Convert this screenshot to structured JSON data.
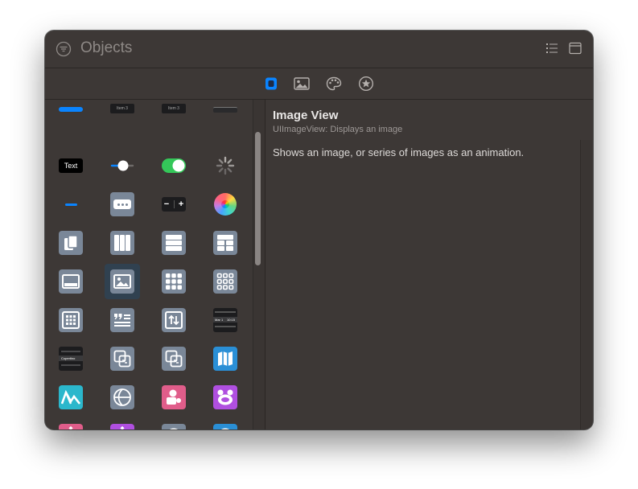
{
  "window": {
    "title": "Objects"
  },
  "tabs": [
    {
      "name": "objects",
      "icon": "objects-icon",
      "active": true
    },
    {
      "name": "media",
      "icon": "image-icon",
      "active": false
    },
    {
      "name": "colors",
      "icon": "palette-icon",
      "active": false
    },
    {
      "name": "snippets",
      "icon": "star-icon",
      "active": false
    }
  ],
  "library": {
    "row0": {
      "item_label_1": "Item 3",
      "item_label_2": "Item 3"
    },
    "row1": {
      "label_text": "Text"
    },
    "row2": {
      "stepper_minus": "−",
      "stepper_plus": "+"
    },
    "row6": {
      "picker_lines": [
        "Cupertino"
      ],
      "date_picker_lines": [
        "Mar 1",
        "10:15"
      ]
    }
  },
  "detail": {
    "title": "Image View",
    "subtitle": "UIImageView: Displays an image",
    "description": "Shows an image, or series of images as an animation."
  },
  "colors": {
    "accent": "#0a84ff",
    "switch_on": "#34c759",
    "tile": "#7a8798",
    "background": "#3d3836"
  }
}
